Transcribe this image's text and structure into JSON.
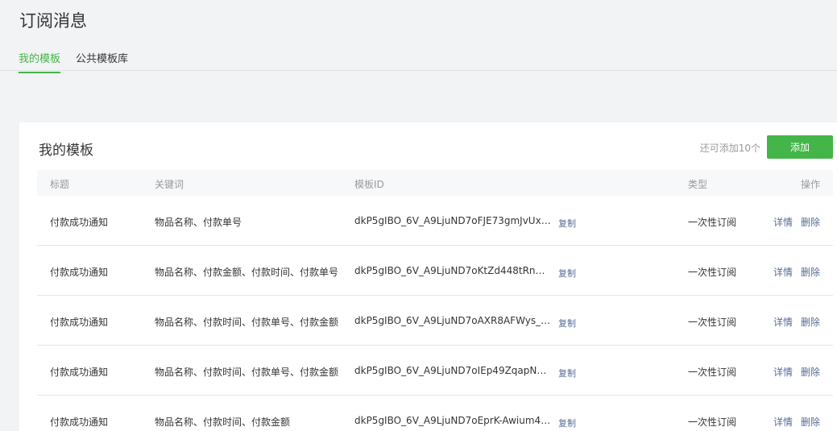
{
  "page_title": "订阅消息",
  "tabs": [
    {
      "label": "我的模板",
      "active": true
    },
    {
      "label": "公共模板库",
      "active": false
    }
  ],
  "panel": {
    "title": "我的模板",
    "remaining": "还可添加10个",
    "add_label": "添加"
  },
  "table": {
    "headers": {
      "title": "标题",
      "keywords": "关键词",
      "template_id": "模板ID",
      "type": "类型",
      "actions": "操作"
    },
    "rows": [
      {
        "title": "付款成功通知",
        "keywords": "物品名称、付款单号",
        "template_id": "dkP5gIBO_6V_A9LjuND7oFJE73gmJvUxRm...",
        "copy": "复制",
        "type": "一次性订阅",
        "detail": "详情",
        "delete": "删除"
      },
      {
        "title": "付款成功通知",
        "keywords": "物品名称、付款金额、付款时间、付款单号",
        "template_id": "dkP5gIBO_6V_A9LjuND7oKtZd448tRnOvD...",
        "copy": "复制",
        "type": "一次性订阅",
        "detail": "详情",
        "delete": "删除"
      },
      {
        "title": "付款成功通知",
        "keywords": "物品名称、付款时间、付款单号、付款金额",
        "template_id": "dkP5gIBO_6V_A9LjuND7oAXR8AFWys_Wy...",
        "copy": "复制",
        "type": "一次性订阅",
        "detail": "详情",
        "delete": "删除"
      },
      {
        "title": "付款成功通知",
        "keywords": "物品名称、付款时间、付款单号、付款金额",
        "template_id": "dkP5gIBO_6V_A9LjuND7oIEp49ZqapNgoQ...",
        "copy": "复制",
        "type": "一次性订阅",
        "detail": "详情",
        "delete": "删除"
      },
      {
        "title": "付款成功通知",
        "keywords": "物品名称、付款时间、付款金额",
        "template_id": "dkP5gIBO_6V_A9LjuND7oEprK-Awium4vk-...",
        "copy": "复制",
        "type": "一次性订阅",
        "detail": "详情",
        "delete": "删除"
      }
    ]
  },
  "colors": {
    "accent": "#44b549",
    "link": "#576b95",
    "background": "#f2f3f5"
  }
}
